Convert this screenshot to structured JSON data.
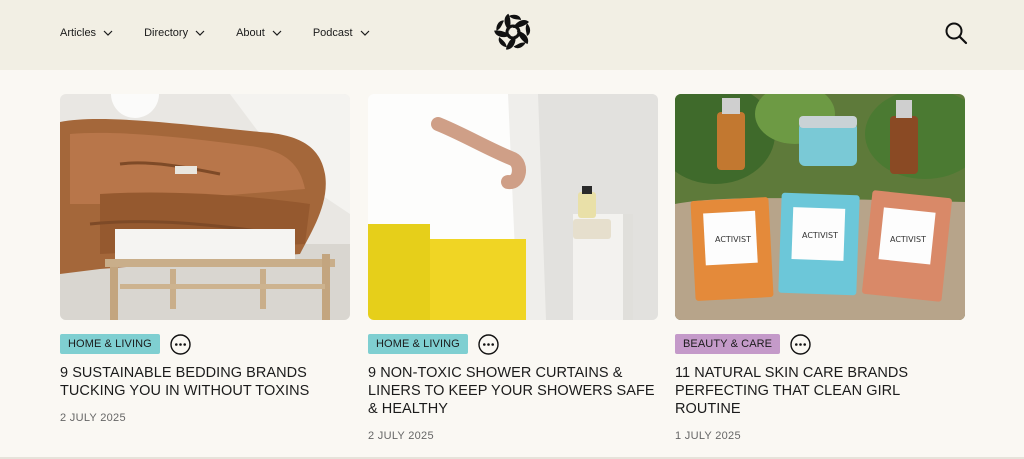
{
  "nav": {
    "items": [
      {
        "label": "Articles"
      },
      {
        "label": "Directory"
      },
      {
        "label": "About"
      },
      {
        "label": "Podcast"
      }
    ]
  },
  "colors": {
    "header_bg": "#f2efe4",
    "page_bg": "#faf8f3",
    "tag_home_living": "#7fcfd1",
    "tag_beauty_care": "#c49ac9"
  },
  "cards": [
    {
      "image": "linen-bedding-photo",
      "tag": "HOME & LIVING",
      "title": "9 SUSTAINABLE BEDDING BRANDS TUCKING YOU IN WITHOUT TOXINS",
      "date": "2 JULY 2025"
    },
    {
      "image": "shower-curtain-photo",
      "tag": "HOME & LIVING",
      "title": "9 NON-TOXIC SHOWER CURTAINS & LINERS TO KEEP YOUR SHOWERS SAFE & HEALTHY",
      "date": "2 JULY 2025"
    },
    {
      "image": "skin-care-products-photo",
      "tag": "BEAUTY & CARE",
      "title": "11 NATURAL SKIN CARE BRANDS PERFECTING THAT CLEAN GIRL ROUTINE",
      "date": "1 JULY 2025"
    }
  ]
}
